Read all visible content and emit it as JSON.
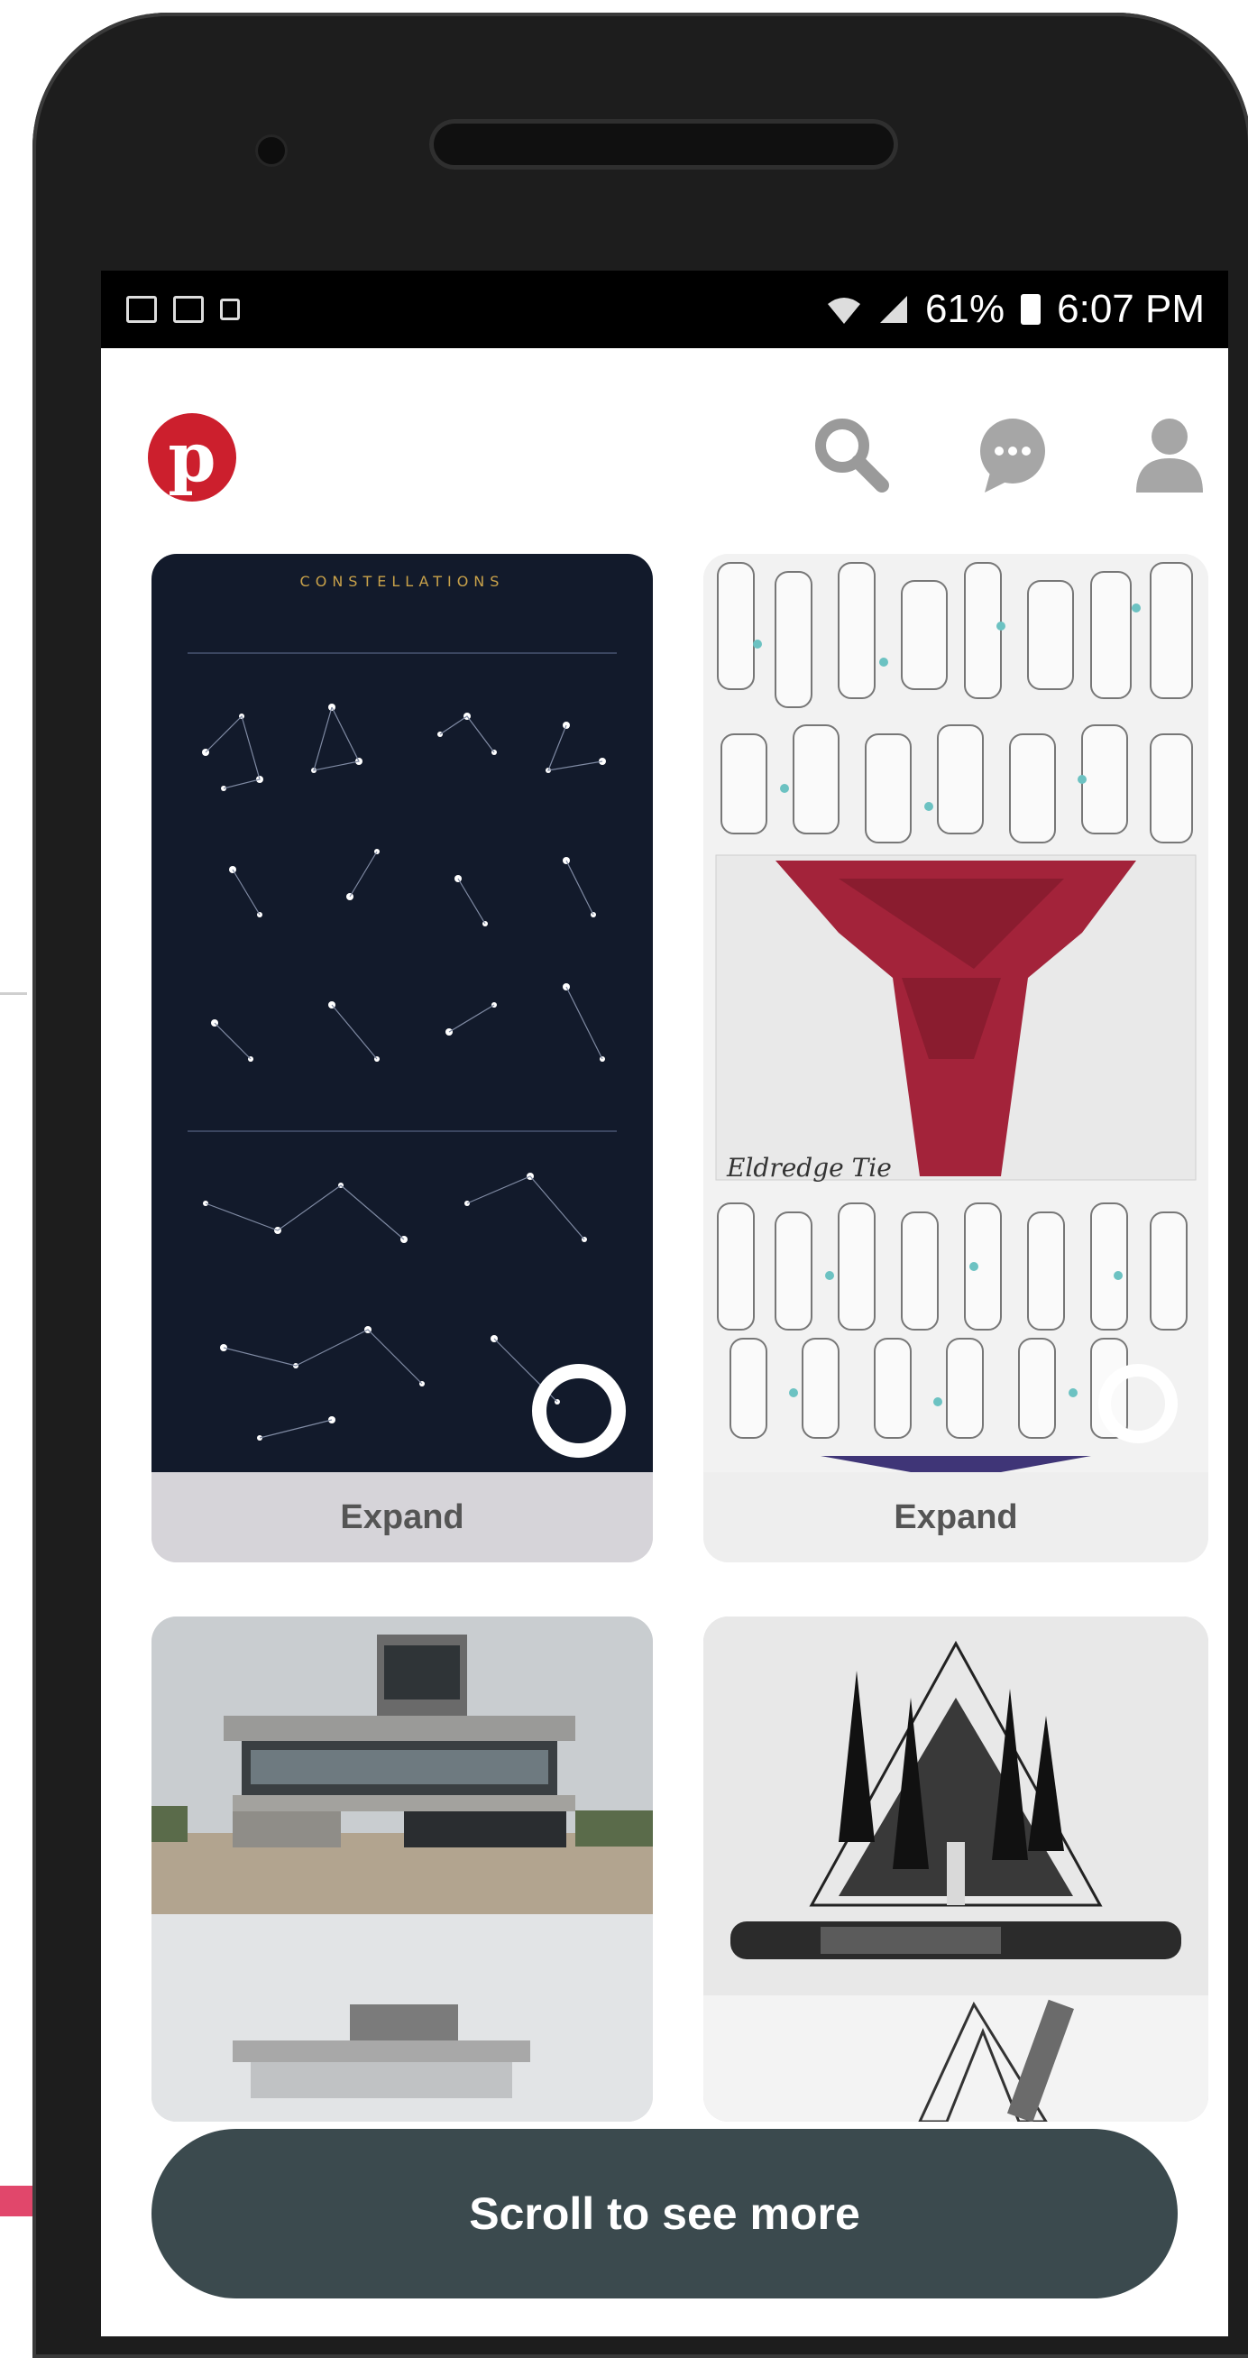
{
  "status_bar": {
    "battery": "61%",
    "time": "6:07 PM",
    "left_icons": [
      "image-notification-icon",
      "gmail-icon",
      "cast-icon"
    ],
    "right_icons": [
      "wifi-icon",
      "signal-icon",
      "battery-icon"
    ]
  },
  "header": {
    "logo_letter": "p",
    "icons": [
      "search-icon",
      "chat-icon",
      "profile-icon"
    ]
  },
  "pins": [
    {
      "title": "CONSTELLATIONS",
      "expand_label": "Expand"
    },
    {
      "title": "Eldredge Tie",
      "expand_label": "Expand"
    }
  ],
  "cta": {
    "label": "Scroll to see more"
  },
  "colors": {
    "brand": "#cc1f2d",
    "cta_bg": "#3b4a4e",
    "expand_bg": "#d6d4d9"
  }
}
